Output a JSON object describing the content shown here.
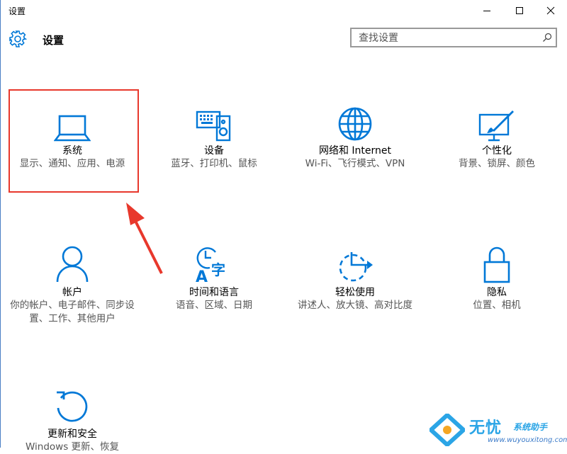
{
  "window": {
    "title": "设置"
  },
  "header": {
    "title": "设置",
    "search_placeholder": "查找设置"
  },
  "tiles": [
    {
      "name": "系统",
      "desc": "显示、通知、应用、电源"
    },
    {
      "name": "设备",
      "desc": "蓝牙、打印机、鼠标"
    },
    {
      "name": "网络和 Internet",
      "desc": "Wi-Fi、飞行模式、VPN"
    },
    {
      "name": "个性化",
      "desc": "背景、锁屏、颜色"
    },
    {
      "name": "帐户",
      "desc": "你的帐户、电子邮件、同步设置、工作、其他用户"
    },
    {
      "name": "时间和语言",
      "desc": "语音、区域、日期"
    },
    {
      "name": "轻松使用",
      "desc": "讲述人、放大镜、高对比度"
    },
    {
      "name": "隐私",
      "desc": "位置、相机"
    },
    {
      "name": "更新和安全",
      "desc": "Windows 更新、恢复"
    }
  ],
  "watermark": {
    "brand": "无忧",
    "sub": "系统助手",
    "url": "www.wuyouxitong.com"
  },
  "colors": {
    "accent": "#0078d7",
    "highlight": "#e8382c"
  }
}
